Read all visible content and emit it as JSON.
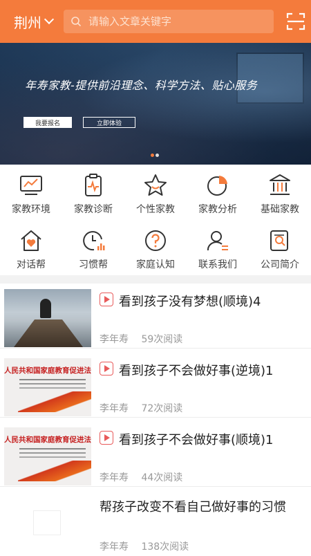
{
  "header": {
    "city": "荆州",
    "search_placeholder": "请输入文章关键字",
    "colors": {
      "bar": "#f47b3c",
      "search_bg": "#f6935f"
    }
  },
  "banner": {
    "slogan": "年寿家教-提供前沿理念、科学方法、贴心服务",
    "btn_signup": "我要报名",
    "btn_try": "立即体验",
    "dots": [
      "#f47b3c",
      "#dddddd"
    ]
  },
  "grid": {
    "items": [
      {
        "label": "家教环境",
        "icon": "monitor-chart-icon"
      },
      {
        "label": "家教诊断",
        "icon": "clipboard-pulse-icon"
      },
      {
        "label": "个性家教",
        "icon": "star-icon"
      },
      {
        "label": "家教分析",
        "icon": "pie-chart-icon"
      },
      {
        "label": "基础家教",
        "icon": "bank-icon"
      },
      {
        "label": "对话帮",
        "icon": "home-heart-icon"
      },
      {
        "label": "习惯帮",
        "icon": "clock-bars-icon"
      },
      {
        "label": "家庭认知",
        "icon": "question-circle-icon"
      },
      {
        "label": "联系我们",
        "icon": "user-contact-icon"
      },
      {
        "label": "公司简介",
        "icon": "doc-search-icon"
      }
    ]
  },
  "articles": [
    {
      "title": "看到孩子没有梦想(顺境)4",
      "author": "李年寿",
      "reads": "59次阅读",
      "thumb": "pier",
      "video": true
    },
    {
      "title": "看到孩子不会做好事(逆境)1",
      "author": "李年寿",
      "reads": "72次阅读",
      "thumb": "law",
      "video": true,
      "thumb_text": "人民共和国家庭教育促进法》"
    },
    {
      "title": "看到孩子不会做好事(顺境)1",
      "author": "李年寿",
      "reads": "44次阅读",
      "thumb": "law",
      "video": true,
      "thumb_text": "人民共和国家庭教育促进法》"
    },
    {
      "title": "帮孩子改变不看自己做好事的习惯",
      "author": "李年寿",
      "reads": "138次阅读",
      "thumb": "blank",
      "video": false
    }
  ]
}
